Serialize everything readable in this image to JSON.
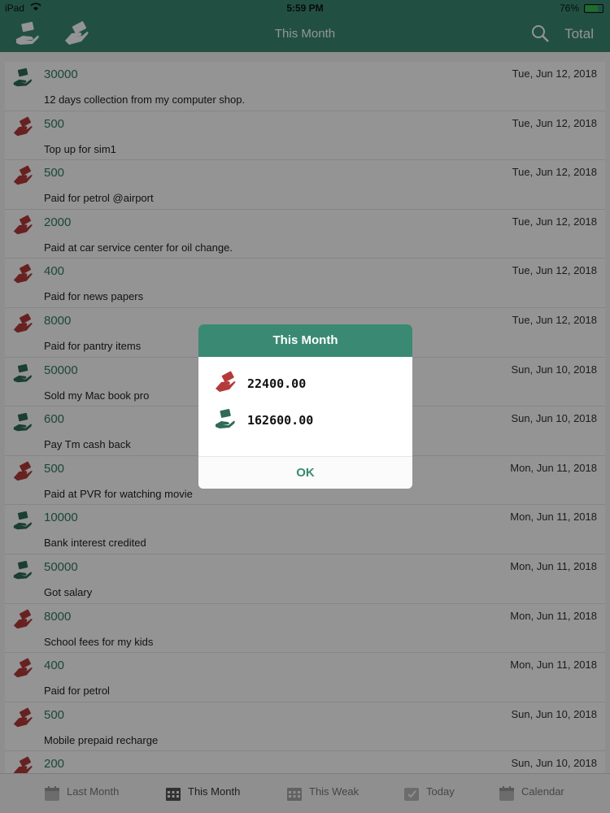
{
  "status_bar": {
    "carrier": "iPad",
    "time": "5:59 PM",
    "battery": "76%"
  },
  "nav": {
    "title": "This Month",
    "total_label": "Total"
  },
  "rows": [
    {
      "type": "income",
      "amount": "30000",
      "date": "Tue, Jun 12, 2018",
      "note": "12 days collection from my computer shop."
    },
    {
      "type": "expense",
      "amount": "500",
      "date": "Tue, Jun 12, 2018",
      "note": "Top up for sim1"
    },
    {
      "type": "expense",
      "amount": "500",
      "date": "Tue, Jun 12, 2018",
      "note": "Paid for petrol @airport"
    },
    {
      "type": "expense",
      "amount": "2000",
      "date": "Tue, Jun 12, 2018",
      "note": "Paid at car service center for oil change."
    },
    {
      "type": "expense",
      "amount": "400",
      "date": "Tue, Jun 12, 2018",
      "note": "Paid for news papers"
    },
    {
      "type": "expense",
      "amount": "8000",
      "date": "Tue, Jun 12, 2018",
      "note": "Paid for pantry items"
    },
    {
      "type": "income",
      "amount": "50000",
      "date": "Sun, Jun 10, 2018",
      "note": "Sold my Mac book pro"
    },
    {
      "type": "income",
      "amount": "600",
      "date": "Sun, Jun 10, 2018",
      "note": "Pay Tm cash back"
    },
    {
      "type": "expense",
      "amount": "500",
      "date": "Mon, Jun 11, 2018",
      "note": "Paid at PVR for watching movie"
    },
    {
      "type": "income",
      "amount": "10000",
      "date": "Mon, Jun 11, 2018",
      "note": "Bank interest credited"
    },
    {
      "type": "income",
      "amount": "50000",
      "date": "Mon, Jun 11, 2018",
      "note": "Got salary"
    },
    {
      "type": "expense",
      "amount": "8000",
      "date": "Mon, Jun 11, 2018",
      "note": "School fees for my kids"
    },
    {
      "type": "expense",
      "amount": "400",
      "date": "Mon, Jun 11, 2018",
      "note": "Paid for petrol"
    },
    {
      "type": "expense",
      "amount": "500",
      "date": "Sun, Jun 10, 2018",
      "note": "Mobile prepaid recharge"
    },
    {
      "type": "expense",
      "amount": "200",
      "date": "Sun, Jun 10, 2018",
      "note": ""
    }
  ],
  "tabs": [
    {
      "key": "last",
      "label": "Last Month",
      "icon": "calendar-icon",
      "active": false
    },
    {
      "key": "month",
      "label": "This Month",
      "icon": "grid-calendar-icon",
      "active": true
    },
    {
      "key": "week",
      "label": "This Weak",
      "icon": "grid-calendar-icon",
      "active": false
    },
    {
      "key": "today",
      "label": "Today",
      "icon": "check-calendar-icon",
      "active": false
    },
    {
      "key": "cal",
      "label": "Calendar",
      "icon": "calendar-icon",
      "active": false
    }
  ],
  "dialog": {
    "title": "This Month",
    "expense_total": "22400.00",
    "income_total": "162600.00",
    "ok_label": "OK"
  },
  "colors": {
    "brand": "#3a8a73",
    "amount": "#2f7a62",
    "expense_icon": "#b43a3a",
    "income_icon": "#2f6b58"
  }
}
